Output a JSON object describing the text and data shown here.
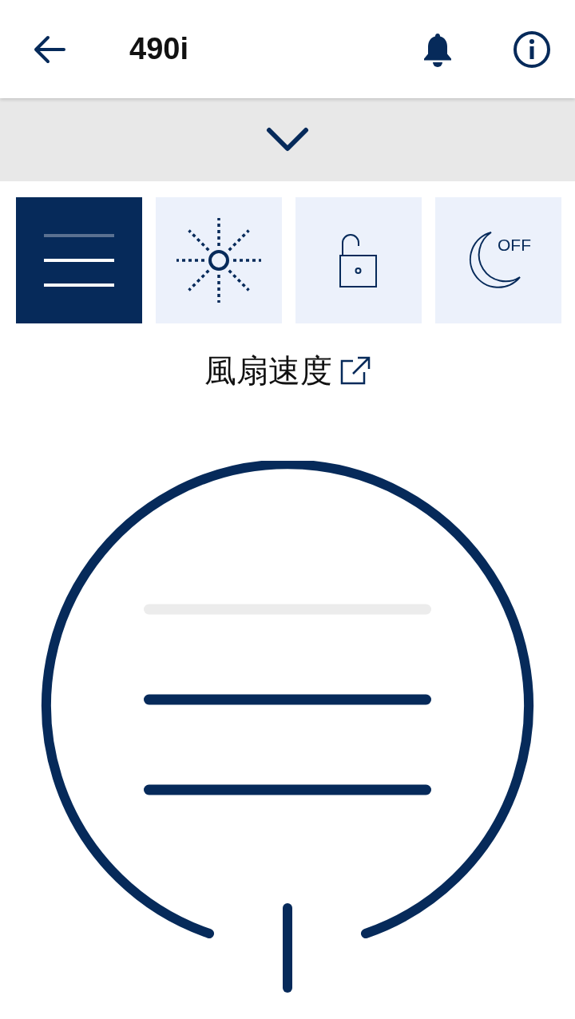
{
  "header": {
    "title": "490i"
  },
  "modes": [
    {
      "kind": "fan",
      "selected": true
    },
    {
      "kind": "light",
      "selected": false
    },
    {
      "kind": "lock",
      "selected": false
    },
    {
      "kind": "sleep",
      "selected": false,
      "label": "OFF"
    }
  ],
  "mode_title": "風扇速度",
  "speed_bars": [
    {
      "lit": false
    },
    {
      "lit": true
    },
    {
      "lit": true
    }
  ]
}
